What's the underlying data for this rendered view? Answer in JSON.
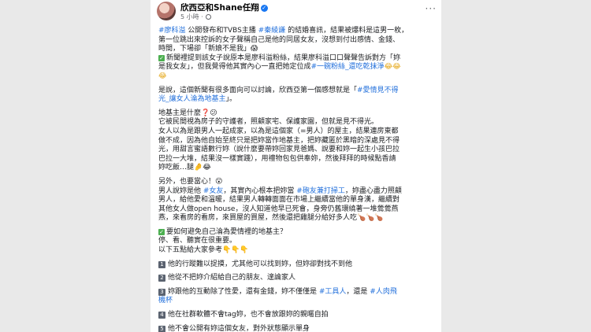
{
  "post": {
    "author": "欣西亞和Shane任翔",
    "time": "5 小時",
    "more_label": "···"
  },
  "paragraphs": {
    "p1": {
      "l1_tag": "#廖科溢",
      "l1_a": " 公開發布和TVBS主播 ",
      "l1_tag2": "#秦綾謙",
      "l1_b": " 的結婚喜訊，結果被爆料是這男一枚，",
      "l2": "第一位跳出來控訴的女子聲稱自己是他的同居女友，沒想到付出感情、金錢、",
      "l3": "時間，下場卻「新娘不是我」😱",
      "l4": "新聞裡提到該女子說原本是廖科溢粉絲，結果廖科溢口口聲聲告訴對方「妳",
      "l5_a": "是我女友」，但我覺得他其實內心一直把她定位成",
      "l5_tag": "#一碗粉絲_還吃乾抹淨",
      "l5_emo": "😂😂",
      "l6": "😂"
    },
    "p2": {
      "l1_a": "是說，這個新聞有很多面向可以討論，欣西亞第一個感想就是「",
      "l1_tag": "#愛情見不得",
      "l2_tag": "光_讓女人淪為地基主",
      "l2_b": "」。"
    },
    "p3": {
      "l1": "地基主是什麼❓😕",
      "l2": "它被民間視為房子的守護者，照顧家宅、保護家園，但就是見不得光。",
      "l3": "女人以為是跟男人一起成家，以為是這個家（=男人）的屋主，結果連房東都",
      "l4": "做不成，因為他自始至終只是把妳當作地基主，把妳藏匿於黑暗的深處見不得",
      "l5": "光，用甜言蜜語數行妳（說什麼要帶妳回家見爸媽、說要和妳一起生小孩巴拉",
      "l6": "巴拉一大堆，結果沒一樣實踐），用禮物包包供奉妳，然後拜拜的時候點香請",
      "l7": "妳吃飯…腿🤌😂"
    },
    "p4": {
      "l1": "另外，也要當心！😮",
      "l2_a": "男人說妳是他 ",
      "l2_tag": "#女友",
      "l2_b": "，其實內心根本把妳當 ",
      "l2_tag2": "#砲友兼打掃工",
      "l2_c": "，妳盡心盡力照顧",
      "l3": "男人，給他愛和溫暖，結果男人轉轉面面在市場上繼續當他的單身漢，繼續對",
      "l4": "其他女人做open house，沒人知道他早已死會，身旁仍舊環繞著一堆鶯鶯燕",
      "l5": "燕，來看房的看房，來買屋的買屋，然後還把雞腿分給好多人吃🍗🍗🍗"
    },
    "p5": {
      "l1": "要如何避免自己淪為愛情裡的地基主？",
      "l2": "停、看、聽實在很重要。",
      "l3": "以下五點給大家參考👇👇👇"
    },
    "items": {
      "i1": "他的行蹤難以捉摸，尤其他可以找到妳，但妳卻對找不到他",
      "i2": "他從不把妳介紹給自己的朋友、遑論家人",
      "i3_a": "妳跟他的互動除了性愛，還有金錢，妳不僅僅是 ",
      "i3_tag": "#工具人",
      "i3_b": "，還是 ",
      "i3_tag2": "#人肉飛",
      "i3_c": "機杯",
      "i4": "他在社群軟體不會tag妳，也不會放跟妳的親暱自拍",
      "i5": "他不會公開有妳這個女友，對外狀態顯示單身"
    }
  },
  "colors": {
    "link": "#216fdb",
    "text": "#1c1e21",
    "background": "#e9e9e9"
  },
  "icons": [
    "avatar",
    "verified-icon",
    "globe-icon",
    "more-icon",
    "check-icon",
    "keycap-number-icon"
  ]
}
